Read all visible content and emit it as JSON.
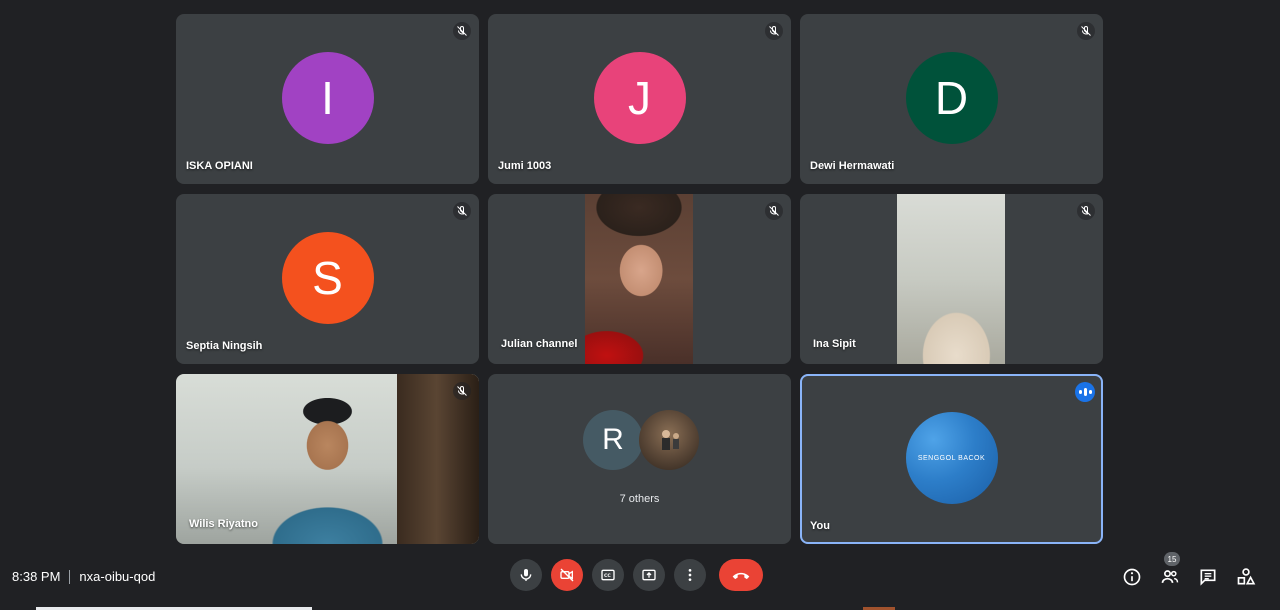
{
  "participants": [
    {
      "name": "ISKA OPIANI",
      "initial": "I",
      "color": "#a142c3"
    },
    {
      "name": "Jumi 1003",
      "initial": "J",
      "color": "#e8437a"
    },
    {
      "name": "Dewi Hermawati",
      "initial": "D",
      "color": "#00523a"
    },
    {
      "name": "Septia Ningsih",
      "initial": "S",
      "color": "#f4511e"
    },
    {
      "name": "Julian channel"
    },
    {
      "name": "Ina Sipit"
    },
    {
      "name": "Wilis Riyatno"
    }
  ],
  "others": {
    "initial": "R",
    "initial_color": "#455a64",
    "label": "7 others"
  },
  "self": {
    "name": "You",
    "avatar_text": "SENGGOL BACOK"
  },
  "footer": {
    "time": "8:38 PM",
    "meeting_code": "nxa-oibu-qod",
    "people_count": "15"
  },
  "icons": {
    "mic": "mic-icon",
    "camera_off": "camera-off-icon",
    "captions": "captions-icon",
    "present": "present-screen-icon",
    "more": "more-vert-icon",
    "end_call": "end-call-icon",
    "info": "info-icon",
    "people": "people-icon",
    "chat": "chat-icon",
    "activities": "activities-icon"
  }
}
